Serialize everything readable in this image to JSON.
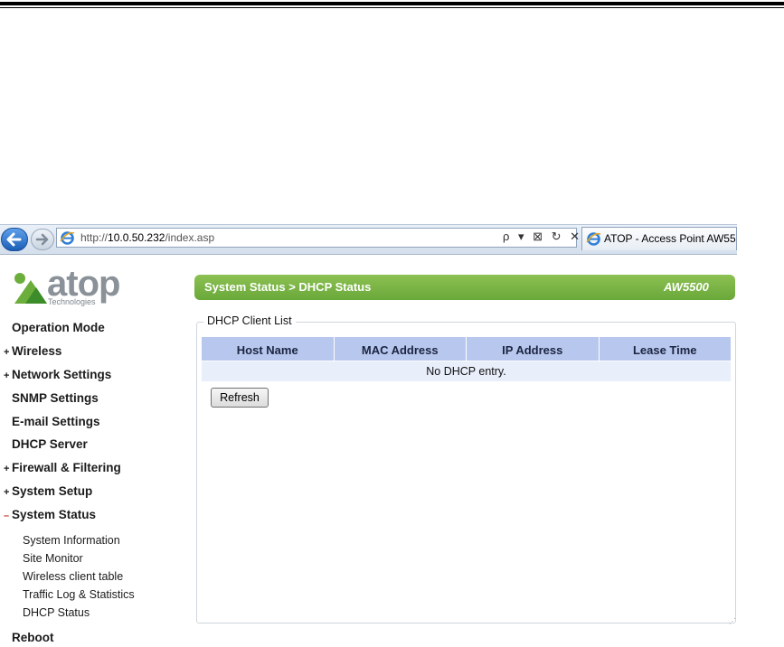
{
  "browser": {
    "url_prefix": "http://",
    "url_host": "10.0.50.232",
    "url_path": "/index.asp",
    "tools": "ρ ▾ ⊠ ↻ ✕",
    "tab_title": "ATOP - Access Point AW55..."
  },
  "logo": {
    "name": "atop",
    "subtitle": "Technologies"
  },
  "sidebar": {
    "items": [
      {
        "prefix": "",
        "label": "Operation Mode"
      },
      {
        "prefix": "+",
        "label": "Wireless"
      },
      {
        "prefix": "+",
        "label": "Network Settings"
      },
      {
        "prefix": "",
        "label": "SNMP Settings"
      },
      {
        "prefix": "",
        "label": "E-mail Settings"
      },
      {
        "prefix": "",
        "label": "DHCP Server"
      },
      {
        "prefix": "+",
        "label": "Firewall & Filtering"
      },
      {
        "prefix": "+",
        "label": "System Setup"
      },
      {
        "prefix": "–",
        "label": "System Status"
      }
    ],
    "sub_items": [
      {
        "label": "System Information"
      },
      {
        "label": "Site Monitor"
      },
      {
        "label": "Wireless client table"
      },
      {
        "label": "Traffic Log & Statistics"
      },
      {
        "label": "DHCP Status"
      }
    ],
    "reboot": "Reboot"
  },
  "header": {
    "title": "System Status > DHCP Status",
    "model": "AW5500"
  },
  "panel": {
    "legend": "DHCP Client List",
    "columns": [
      "Host Name",
      "MAC Address",
      "IP Address",
      "Lease Time"
    ],
    "empty_message": "No DHCP entry.",
    "refresh_label": "Refresh"
  },
  "colors": {
    "header_green": "#7ab648",
    "table_header": "#b8c7ee",
    "table_row": "#e8eefa"
  }
}
